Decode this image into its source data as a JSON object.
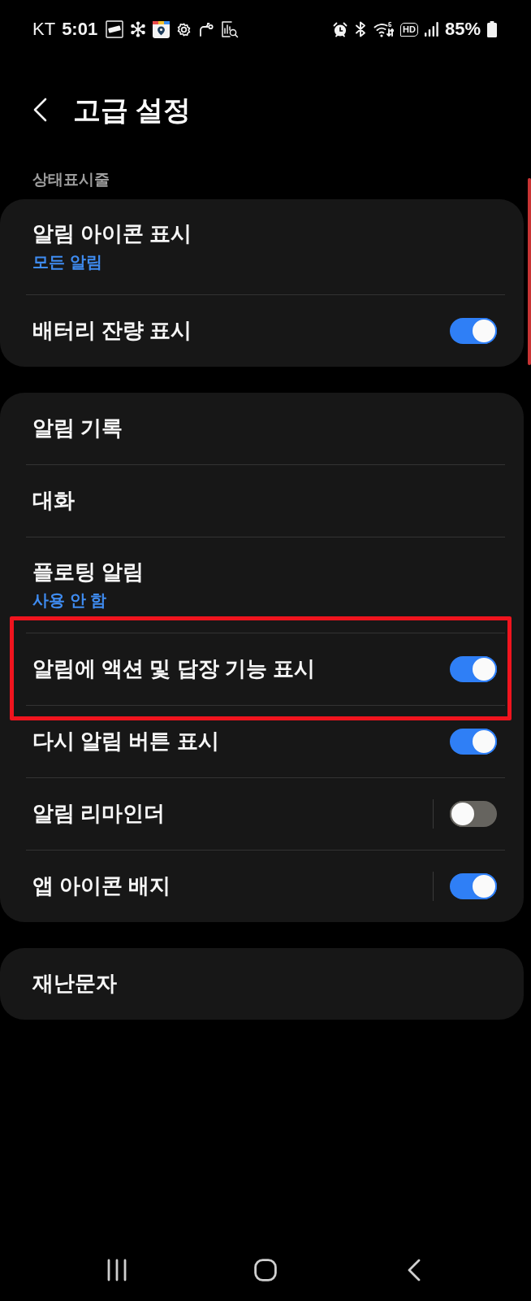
{
  "status_bar": {
    "carrier": "KT",
    "time": "5:01",
    "hd_label": "HD",
    "battery_text": "85%"
  },
  "header": {
    "title": "고급 설정"
  },
  "sections": [
    {
      "label": "상태표시줄",
      "items": [
        {
          "title": "알림 아이콘 표시",
          "summary": "모든 알림",
          "kind": "link",
          "highlighted": false
        },
        {
          "title": "배터리 잔량 표시",
          "kind": "switch",
          "on": true,
          "highlighted": false
        }
      ]
    },
    {
      "items": [
        {
          "title": "알림 기록",
          "kind": "link",
          "highlighted": false
        },
        {
          "title": "대화",
          "kind": "link",
          "highlighted": false
        },
        {
          "title": "플로팅 알림",
          "summary": "사용 안 함",
          "kind": "link",
          "highlighted": false
        },
        {
          "title": "알림에 액션 및 답장 기능 표시",
          "kind": "switch",
          "on": true,
          "highlighted": true
        },
        {
          "title": "다시 알림 버튼 표시",
          "kind": "switch",
          "on": true,
          "highlighted": false
        },
        {
          "title": "알림 리마인더",
          "kind": "split_switch",
          "on": false,
          "highlighted": false
        },
        {
          "title": "앱 아이콘 배지",
          "kind": "split_switch",
          "on": true,
          "highlighted": false
        }
      ]
    },
    {
      "items": [
        {
          "title": "재난문자",
          "kind": "link",
          "highlighted": false
        }
      ]
    }
  ]
}
